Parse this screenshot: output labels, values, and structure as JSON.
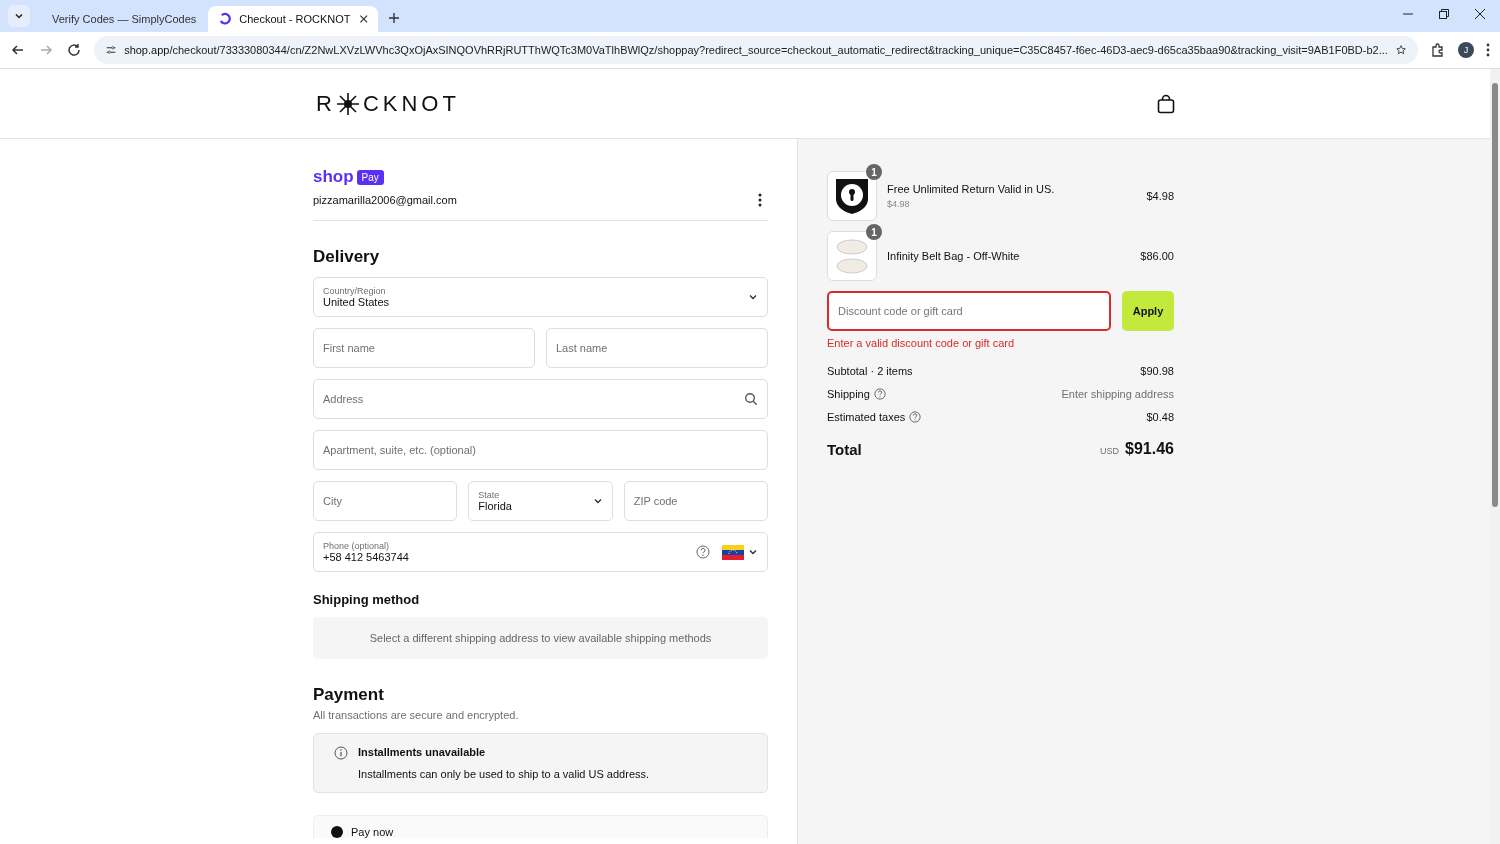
{
  "browser": {
    "tabs": [
      {
        "title": "Verify Codes — SimplyCodes",
        "selected": false,
        "kind": "simplycodes"
      },
      {
        "title": "Checkout - ROCKNOT",
        "selected": true,
        "kind": "shop"
      }
    ],
    "url_host": "shop.app",
    "url_rest": "/checkout/73333080344/cn/Z2NwLXVzLWVhc3QxOjAxSINQOVhRRjRUTThWQTc3M0VaTlhBWlQz/shoppay?redirect_source=checkout_automatic_redirect&tracking_unique=C35C8457-f6ec-46D3-aec9-d65ca35baa90&tracking_visit=9AB1F0BD-b2...",
    "profile_initial": "J"
  },
  "header": {
    "logo_before": "R",
    "logo_after": "CKNOT"
  },
  "account": {
    "shop": "shop",
    "pay": "Pay",
    "email": "pizzamarilla2006@gmail.com"
  },
  "delivery": {
    "title": "Delivery",
    "rows": [
      [
        {
          "kind": "select",
          "label": "Country/Region",
          "value": "United States"
        }
      ],
      [
        {
          "kind": "text",
          "placeholder": "First name"
        },
        {
          "kind": "text",
          "placeholder": "Last name"
        }
      ],
      [
        {
          "kind": "search",
          "placeholder": "Address"
        }
      ],
      [
        {
          "kind": "text",
          "placeholder": "Apartment, suite, etc. (optional)"
        }
      ],
      [
        {
          "kind": "text",
          "placeholder": "City"
        },
        {
          "kind": "select",
          "label": "State",
          "value": "Florida"
        },
        {
          "kind": "text",
          "placeholder": "ZIP code"
        }
      ],
      [
        {
          "kind": "phone",
          "label": "Phone (optional)",
          "value": "+58 412 5463744"
        }
      ]
    ]
  },
  "shipping_method": {
    "title": "Shipping method",
    "message": "Select a different shipping address to view available shipping methods"
  },
  "payment": {
    "title": "Payment",
    "subtitle": "All transactions are secure and encrypted.",
    "notice_title": "Installments unavailable",
    "notice_text": "Installments can only be used to ship to a valid US address.",
    "option": "Pay now"
  },
  "order": {
    "items": [
      {
        "kind": "shield",
        "quantity": "1",
        "name": "Free Unlimited Return Valid in US.",
        "unit_price": "$4.98",
        "price": "$4.98"
      },
      {
        "kind": "photo",
        "quantity": "1",
        "name": "Infinity Belt Bag - Off-White",
        "price": "$86.00"
      }
    ],
    "discount": {
      "placeholder": "Discount code or gift card",
      "error": true,
      "error_text": "Enter a valid discount code or gift card",
      "button": "Apply"
    },
    "summary": [
      {
        "label": "Subtotal · 2 items",
        "value": "$90.98",
        "help": false,
        "muted": false
      },
      {
        "label": "Shipping",
        "value": "Enter shipping address",
        "help": true,
        "muted": true
      },
      {
        "label": "Estimated taxes",
        "value": "$0.48",
        "help": true,
        "muted": false
      }
    ],
    "total_label": "Total",
    "currency": "USD",
    "total": "$91.46"
  }
}
